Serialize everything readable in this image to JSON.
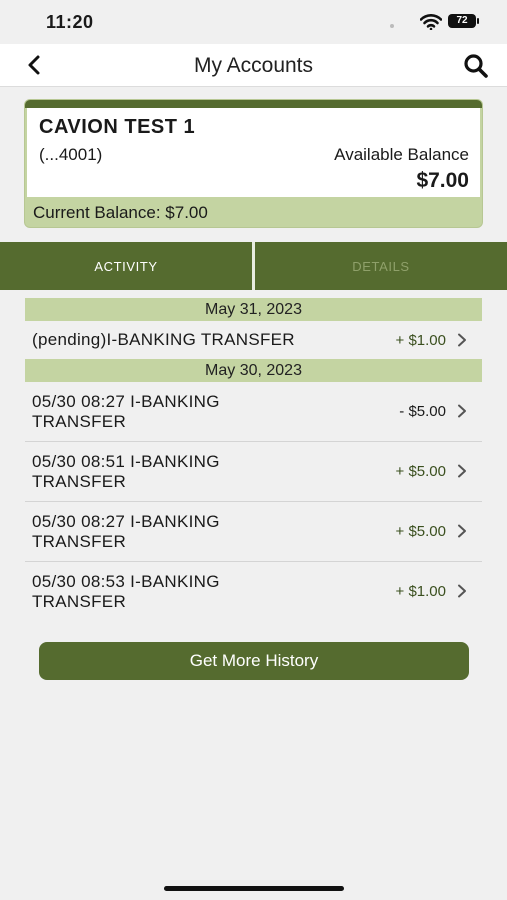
{
  "status_bar": {
    "time": "11:20",
    "battery": "72"
  },
  "nav": {
    "title": "My Accounts",
    "back_icon": "chevron-left-icon",
    "search_icon": "search-icon"
  },
  "account": {
    "name": "CAVION TEST 1",
    "number": "(...4001)",
    "available_label": "Available Balance",
    "available_amount": "$7.00",
    "current_balance": "Current Balance: $7.00"
  },
  "tabs": [
    {
      "label": "ACTIVITY",
      "active": true
    },
    {
      "label": "DETAILS",
      "active": false
    }
  ],
  "activity": [
    {
      "date": "May 31, 2023",
      "transactions": [
        {
          "description": "(pending)I-BANKING TRANSFER",
          "amount": "+ $1.00"
        }
      ]
    },
    {
      "date": "May 30, 2023",
      "transactions": [
        {
          "description": "05/30 08:27 I-BANKING TRANSFER",
          "amount": "- $5.00"
        },
        {
          "description": "05/30 08:51 I-BANKING TRANSFER",
          "amount": "+ $5.00"
        },
        {
          "description": "05/30 08:27 I-BANKING TRANSFER",
          "amount": "+ $5.00"
        },
        {
          "description": "05/30 08:53 I-BANKING TRANSFER",
          "amount": "+ $1.00"
        }
      ]
    }
  ],
  "more_history_label": "Get More History",
  "colors": {
    "brand": "#556b2f",
    "light": "#c4d4a2",
    "background": "#f0f0f0"
  }
}
